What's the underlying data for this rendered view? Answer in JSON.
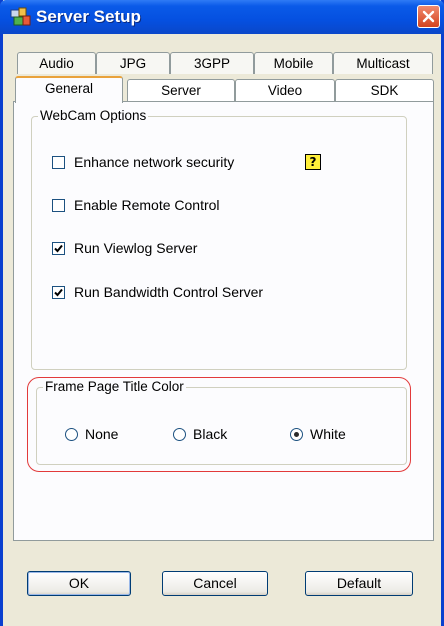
{
  "window": {
    "title": "Server Setup"
  },
  "tabs": {
    "row1": [
      "Audio",
      "JPG",
      "3GPP",
      "Mobile",
      "Multicast"
    ],
    "row2": [
      "General",
      "Server",
      "Video",
      "SDK"
    ],
    "active": "General"
  },
  "webcam_options": {
    "label": "WebCam Options",
    "items": [
      {
        "label": "Enhance network security",
        "checked": false
      },
      {
        "label": "Enable Remote Control",
        "checked": false
      },
      {
        "label": "Run Viewlog Server",
        "checked": true
      },
      {
        "label": "Run Bandwidth Control Server",
        "checked": true
      }
    ],
    "help_text": "?"
  },
  "frame_title_color": {
    "label": "Frame Page Title Color",
    "options": [
      {
        "label": "None",
        "selected": false
      },
      {
        "label": "Black",
        "selected": false
      },
      {
        "label": "White",
        "selected": true
      }
    ]
  },
  "buttons": {
    "ok": "OK",
    "cancel": "Cancel",
    "default": "Default"
  },
  "colors": {
    "titlebar": "#0550e0",
    "highlight_outline": "#e23a3a",
    "active_tab_accent": "#e9a23b"
  }
}
